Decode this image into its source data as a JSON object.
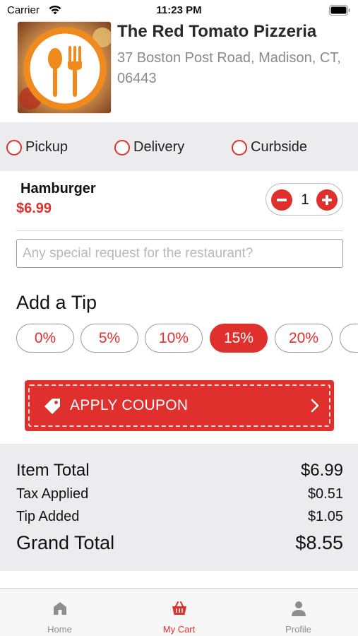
{
  "status_bar": {
    "carrier": "Carrier",
    "time": "11:23 PM"
  },
  "restaurant": {
    "name": "The Red Tomato Pizzeria",
    "address": "37 Boston Post Road, Madison, CT, 06443",
    "logo_icon": "fork-spoon-icon"
  },
  "order_types": [
    {
      "label": "Pickup",
      "selected": false
    },
    {
      "label": "Delivery",
      "selected": false
    },
    {
      "label": "Curbside",
      "selected": false
    }
  ],
  "cart_item": {
    "name": "Hamburger",
    "price": "$6.99",
    "quantity": "1"
  },
  "special_request": {
    "value": "",
    "placeholder": "Any special request for the restaurant?"
  },
  "tip": {
    "title": "Add a Tip",
    "options": [
      "0%",
      "5%",
      "10%",
      "15%",
      "20%"
    ],
    "selected": "15%"
  },
  "coupon": {
    "label": "APPLY COUPON",
    "icon": "tag-icon"
  },
  "totals": {
    "item_total_label": "Item Total",
    "item_total_value": "$6.99",
    "tax_label": "Tax Applied",
    "tax_value": "$0.51",
    "tip_label": "Tip Added",
    "tip_value": "$1.05",
    "grand_total_label": "Grand Total",
    "grand_total_value": "$8.55"
  },
  "tab_bar": {
    "tabs": [
      {
        "label": "Home",
        "icon": "home-icon",
        "active": false
      },
      {
        "label": "My Cart",
        "icon": "basket-icon",
        "active": true
      },
      {
        "label": "Profile",
        "icon": "person-icon",
        "active": false
      }
    ]
  },
  "colors": {
    "accent": "#e0302e",
    "panel_gray": "#ececee",
    "logo_orange": "#f08a1c"
  }
}
